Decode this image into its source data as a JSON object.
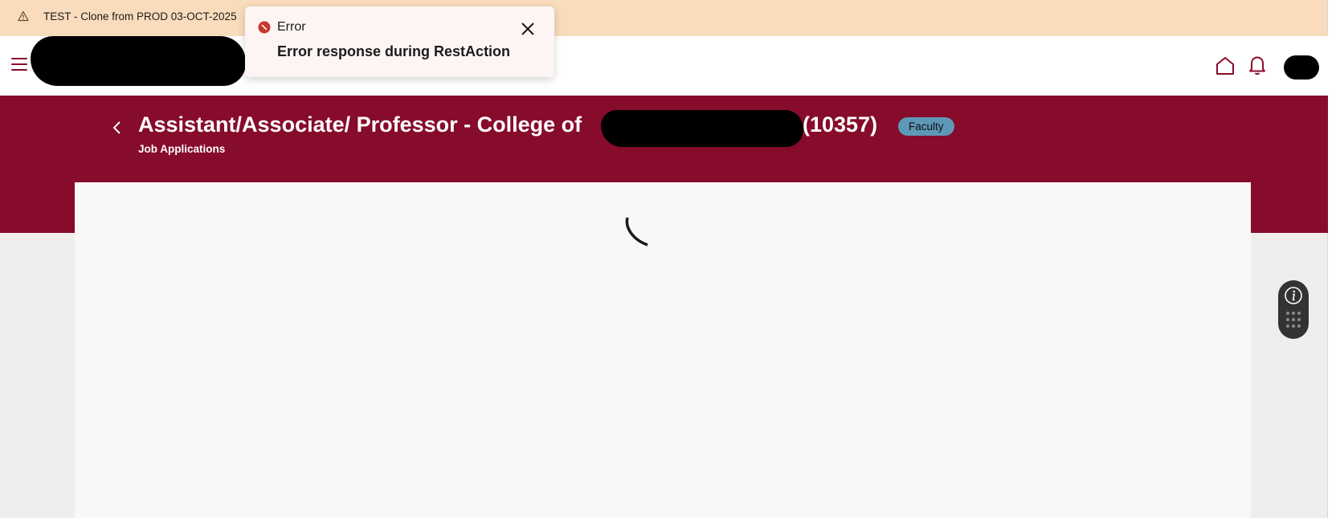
{
  "env_banner": {
    "text": "TEST - Clone from PROD 03-OCT-2025",
    "icon": "warning-icon",
    "color": "#f9dcbc"
  },
  "header": {
    "menu_icon": "hamburger-icon",
    "home_icon": "home-icon",
    "notifications_icon": "bell-icon",
    "accent_color": "#8a0b2b"
  },
  "toast": {
    "icon": "error-icon",
    "title": "Error",
    "message": "Error response during RestAction",
    "close_icon": "close-icon"
  },
  "page": {
    "title_prefix": "Assistant/Associate/ Professor - College of",
    "requisition_id": "(10357)",
    "badge": "Faculty",
    "subtitle": "Job Applications",
    "band_color": "#870b2b",
    "badge_color": "#5d98b7"
  },
  "content": {
    "loading_icon": "spinner-icon"
  },
  "dock": {
    "info_icon": "info-icon",
    "apps_icon": "grid-icon"
  }
}
